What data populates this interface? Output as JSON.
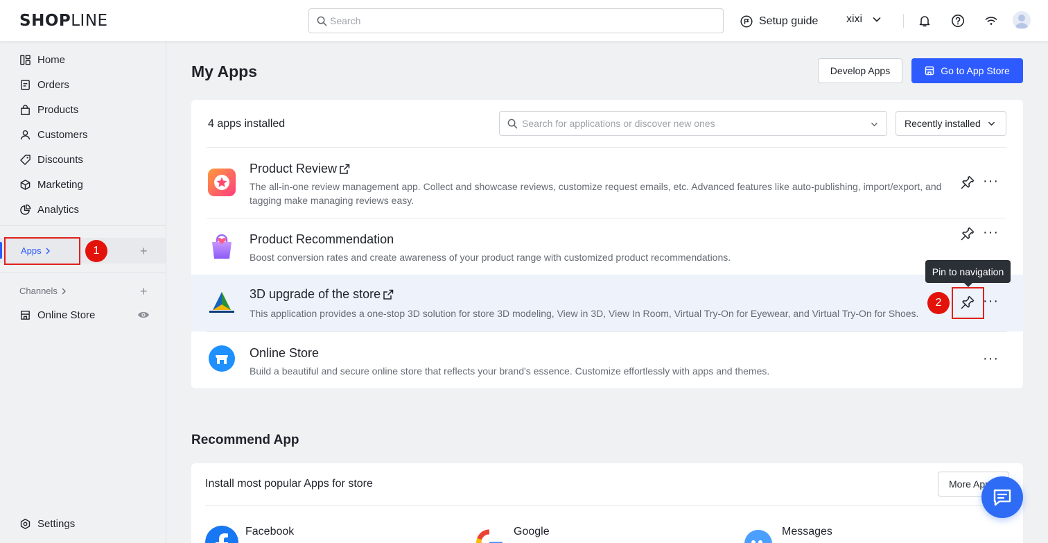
{
  "brand": {
    "logo_bold": "SHOP",
    "logo_thin": "LINE"
  },
  "topbar": {
    "search_placeholder": "Search",
    "setup_guide": "Setup guide",
    "user_name": "xixi"
  },
  "sidebar": {
    "items": [
      {
        "label": "Home",
        "icon": "home-icon"
      },
      {
        "label": "Orders",
        "icon": "orders-icon"
      },
      {
        "label": "Products",
        "icon": "bag-icon"
      },
      {
        "label": "Customers",
        "icon": "person-icon"
      },
      {
        "label": "Discounts",
        "icon": "tag-icon"
      },
      {
        "label": "Marketing",
        "icon": "box-icon"
      },
      {
        "label": "Analytics",
        "icon": "pie-chart-icon"
      }
    ],
    "apps_label": "Apps",
    "channels_label": "Channels",
    "online_store": "Online Store",
    "settings": "Settings"
  },
  "annotations": {
    "step1": "1",
    "step2": "2"
  },
  "main": {
    "title": "My Apps",
    "develop_apps": "Develop Apps",
    "go_to_app_store": "Go to App Store",
    "installed_count": "4 apps installed",
    "app_search_placeholder": "Search for applications or discover new ones",
    "sort_label": "Recently installed",
    "apps": [
      {
        "name": "Product Review",
        "description": "The all-in-one review management app. Collect and showcase reviews, customize request emails, etc. Advanced features like auto-publishing, import/export, and tagging make managing reviews easy."
      },
      {
        "name": "Product Recommendation",
        "description": "Boost conversion rates and create awareness of your product range with customized product recommendations."
      },
      {
        "name": "3D upgrade of the store",
        "description": "This application provides a one-stop 3D solution for store 3D modeling, View in 3D, View In Room, Virtual Try-On for Eyewear, and Virtual Try-On for Shoes."
      },
      {
        "name": "Online Store",
        "description": "Build a beautiful and secure online store that reflects your brand's essence. Customize effortlessly with apps and themes."
      }
    ],
    "tooltip": "Pin to navigation",
    "more_glyph": "···"
  },
  "recommend": {
    "title": "Recommend App",
    "subtitle": "Install most popular Apps for store",
    "more_apps": "More Apps",
    "apps": [
      "Facebook",
      "Google",
      "Messages"
    ]
  },
  "colors": {
    "primary": "#2e5bff",
    "annotation_red": "#e3120b",
    "highlight_row": "#eef3fb"
  }
}
